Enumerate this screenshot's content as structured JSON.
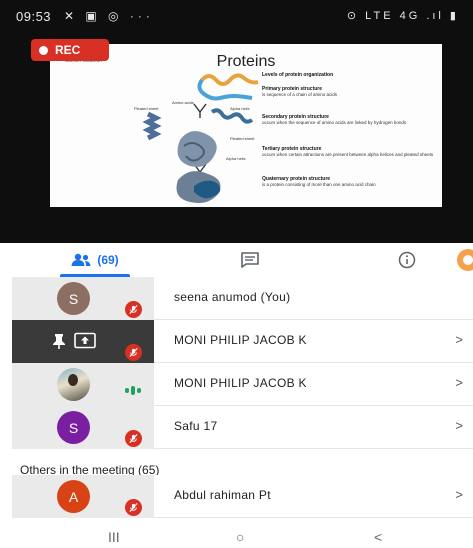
{
  "statusbar": {
    "time": "09:53",
    "left_icons": "✕ ▣ ◎ ···",
    "right_icons": "⊙ LTE 4G .ıl ▮"
  },
  "rec": {
    "label": "REC"
  },
  "slide": {
    "title": "Proteins",
    "logo_text": "AGENCY ACADEMY",
    "levels_heading": "Levels of protein organization",
    "primary": {
      "title": "Primary protein structure",
      "desc": "is sequence of a chain of amino acids"
    },
    "secondary": {
      "title": "Secondary protein structure",
      "desc": "occurs when the sequence of amino acids are linked by hydrogen bonds"
    },
    "tertiary": {
      "title": "Tertiary protein structure",
      "desc": "occurs when certain attractions are present between alpha helices and pleated sheets"
    },
    "quaternary": {
      "title": "Quaternary protein structure",
      "desc": "is a protein consisting of more than one amino acid chain"
    },
    "art_labels": {
      "amino": "Amino acids",
      "pleated": "Pleated sheet",
      "alpha": "Alpha helix",
      "pleated2": "Pleated sheet",
      "alpha2": "Alpha helix"
    }
  },
  "tabs": {
    "people_count": "(69)",
    "active_color": "#1a73e8"
  },
  "participants": [
    {
      "name": "seena anumod (You)",
      "initial": "S",
      "avatar_color": "#8d6e63",
      "state": "muted"
    },
    {
      "name": "MONI PHILIP JACOB K",
      "state": "presenting"
    },
    {
      "name": "MONI PHILIP JACOB K",
      "state": "speaking"
    },
    {
      "name": "Safu 17",
      "initial": "S",
      "avatar_color": "#7b1fa2",
      "state": "muted"
    }
  ],
  "others": {
    "heading": "Others in the meeting (65)",
    "items": [
      {
        "name": "Abdul rahiman Pt",
        "initial": "A",
        "avatar_color": "#d84315",
        "state": "muted"
      }
    ]
  },
  "navbar": {
    "recents": "III",
    "home": "○",
    "back": "<"
  },
  "chevron": ">"
}
